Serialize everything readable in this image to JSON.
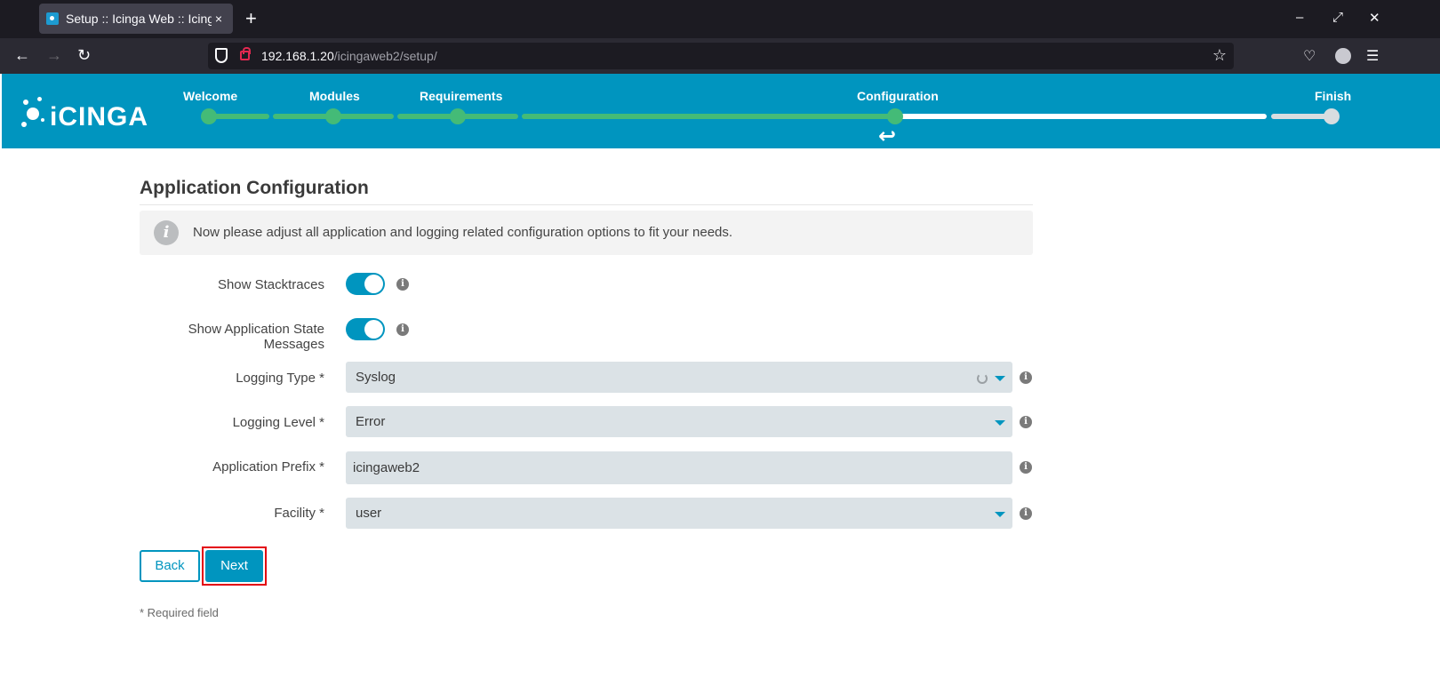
{
  "browser": {
    "tab_title": "Setup :: Icinga Web :: Icinga Web",
    "tab_close": "×",
    "new_tab": "+",
    "url_host": "192.168.1.20",
    "url_path": "/icingaweb2/setup/",
    "minimize": "–",
    "maximize": "⤢",
    "close": "✕"
  },
  "app": {
    "logo": "iCINGA",
    "steps": [
      {
        "label": "Welcome",
        "state": "done"
      },
      {
        "label": "Modules",
        "state": "done"
      },
      {
        "label": "Requirements",
        "state": "done"
      },
      {
        "label": "Configuration",
        "state": "current"
      },
      {
        "label": "Finish",
        "state": "future"
      }
    ]
  },
  "page": {
    "title": "Application Configuration",
    "info": "Now please adjust all application and logging related configuration options to fit your needs.",
    "fields": {
      "show_stacktraces": {
        "label": "Show Stacktraces",
        "enabled": true
      },
      "show_state_messages": {
        "label_line1": "Show Application State",
        "label_line2": "Messages",
        "enabled": true
      },
      "logging_type": {
        "label": "Logging Type *",
        "value": "Syslog"
      },
      "logging_level": {
        "label": "Logging Level *",
        "value": "Error"
      },
      "app_prefix": {
        "label": "Application Prefix *",
        "value": "icingaweb2"
      },
      "facility": {
        "label": "Facility *",
        "value": "user"
      }
    },
    "back_label": "Back",
    "next_label": "Next",
    "required_note": "* Required field"
  },
  "colors": {
    "brand": "#0095bf",
    "progress_done": "#44bb77",
    "highlight": "#e3000f"
  }
}
